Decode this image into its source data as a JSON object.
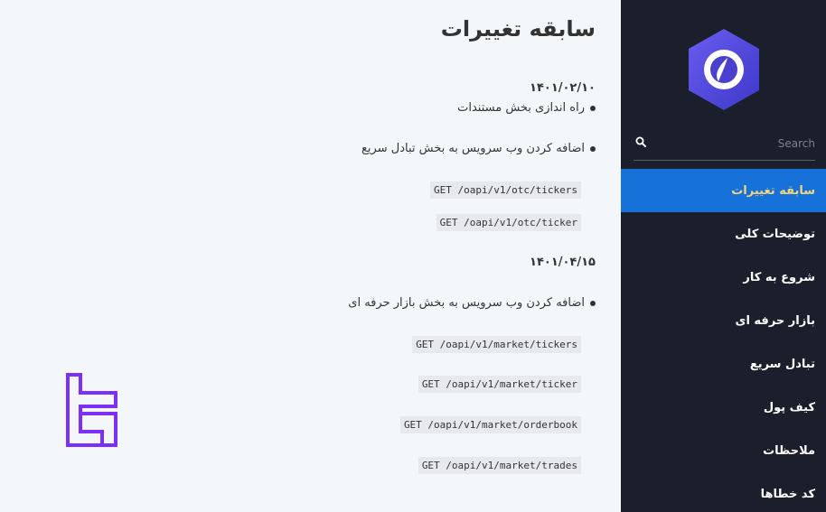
{
  "search": {
    "placeholder": "Search"
  },
  "sidebar": {
    "items": [
      {
        "label": "سابقه تغییرات",
        "active": true
      },
      {
        "label": "توضیحات کلی"
      },
      {
        "label": "شروع به کار"
      },
      {
        "label": "بازار حرفه ای"
      },
      {
        "label": "تبادل سریع"
      },
      {
        "label": "کیف پول"
      },
      {
        "label": "ملاحظات"
      },
      {
        "label": "کد خطاها"
      }
    ]
  },
  "main": {
    "title": "سابقه تغییرات",
    "sections": [
      {
        "date": "۱۴۰۱/۰۲/۱۰",
        "bullets": [
          "راه اندازی بخش مستندات",
          "اضافه کردن وب سرویس به بخش تبادل سریع"
        ],
        "endpoints": [
          "GET /oapi/v1/otc/tickers",
          "GET /oapi/v1/otc/ticker"
        ]
      },
      {
        "date": "۱۴۰۱/۰۴/۱۵",
        "bullets": [
          "اضافه کردن وب سرویس به بخش بازار حرفه ای"
        ],
        "endpoints": [
          "GET /oapi/v1/market/tickers",
          "GET /oapi/v1/market/ticker",
          "GET /oapi/v1/market/orderbook",
          "GET /oapi/v1/market/trades"
        ]
      }
    ]
  },
  "colors": {
    "sidebar_bg": "#1b1f2b",
    "active_bg": "#1672d9",
    "active_text": "#f5d47a",
    "logo_purple": "#5b4fe0",
    "brand_purple": "#7b2ff7"
  }
}
